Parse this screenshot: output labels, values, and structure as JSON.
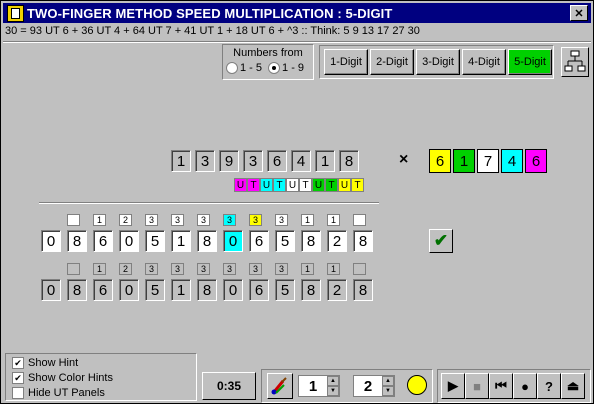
{
  "window": {
    "title": "TWO-FINGER METHOD SPEED MULTIPLICATION : 5-DIGIT",
    "close_label": "✕"
  },
  "formula": "30 = 93 UT 6 + 36 UT 4 + 64 UT 7 + 41 UT 1 + 18 UT 6 + ^3 :: Think:  5  9  13  17  27  30",
  "numbers_from": {
    "label": "Numbers from",
    "options": [
      "1 - 5",
      "1 - 9"
    ],
    "selected": "1 - 9"
  },
  "digit_buttons": [
    "1-Digit",
    "2-Digit",
    "3-Digit",
    "4-Digit",
    "5-Digit"
  ],
  "active_digit": "5-Digit",
  "multiplicand": [
    "1",
    "3",
    "9",
    "3",
    "6",
    "4",
    "1",
    "8"
  ],
  "times_symbol": "×",
  "multiplier": [
    {
      "digit": "6",
      "color": "#ffff00"
    },
    {
      "digit": "1",
      "color": "#00d000"
    },
    {
      "digit": "7",
      "color": "#ffffff"
    },
    {
      "digit": "4",
      "color": "#00ffff"
    },
    {
      "digit": "6",
      "color": "#ff00ff"
    }
  ],
  "ut_panel": [
    {
      "t": "U",
      "c": "#ff00ff"
    },
    {
      "t": "T",
      "c": "#ff00ff"
    },
    {
      "t": "U",
      "c": "#00ffff"
    },
    {
      "t": "T",
      "c": "#00ffff"
    },
    {
      "t": "U",
      "c": "#ffffff"
    },
    {
      "t": "T",
      "c": "#ffffff"
    },
    {
      "t": "U",
      "c": "#00d000"
    },
    {
      "t": "T",
      "c": "#00d000"
    },
    {
      "t": "U",
      "c": "#ffff00"
    },
    {
      "t": "T",
      "c": "#ffff00"
    }
  ],
  "answer_carries": [
    "",
    "1",
    "2",
    "3",
    "3",
    "3",
    "3",
    "3",
    "3",
    "1",
    "1",
    ""
  ],
  "answer_carry_styles": [
    "",
    "",
    "",
    "",
    "",
    "",
    "cyan",
    "yellow",
    "",
    "",
    "",
    ""
  ],
  "answer_digits": [
    "0",
    "8",
    "6",
    "0",
    "5",
    "1",
    "8",
    "0",
    "6",
    "5",
    "8",
    "2",
    "8"
  ],
  "answer_highlight_index": 7,
  "key_carries": [
    "",
    "1",
    "2",
    "3",
    "3",
    "3",
    "3",
    "3",
    "3",
    "1",
    "1",
    ""
  ],
  "key_digits": [
    "0",
    "8",
    "6",
    "0",
    "5",
    "1",
    "8",
    "0",
    "6",
    "5",
    "8",
    "2",
    "8"
  ],
  "check_icon": "✔",
  "options": [
    {
      "label": "Show Hint",
      "checked": true
    },
    {
      "label": "Show Color Hints",
      "checked": true
    },
    {
      "label": "Hide UT Panels",
      "checked": false
    }
  ],
  "timer": "0:35",
  "spinner1": "1",
  "spinner2": "2",
  "playback_icons": [
    "play-icon",
    "stop-icon",
    "skip-back-icon",
    "record-icon",
    "help-icon",
    "eject-icon"
  ]
}
